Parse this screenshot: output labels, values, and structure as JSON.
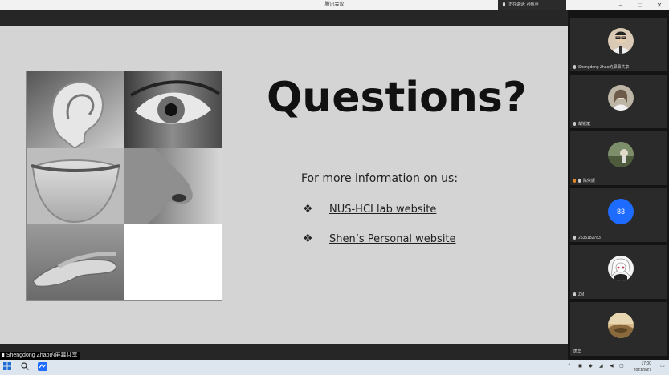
{
  "window": {
    "title": "腾讯会议",
    "controls": [
      "–",
      "□",
      "✕"
    ]
  },
  "speaking": {
    "label": "正在讲话: 孙帆丝"
  },
  "slide": {
    "headline": "Questions?",
    "info": "For more information on us:",
    "bullet": "❖",
    "links": [
      "NUS-HCI lab website",
      "Shen’s Personal website"
    ]
  },
  "share": {
    "label": "Shengdong Zhao的屏幕共享"
  },
  "participants": [
    {
      "name": "Shengdong Zhao的屏幕共享",
      "avatar": "man-glasses"
    },
    {
      "name": "胡锐斌",
      "avatar": "woman-portrait"
    },
    {
      "name": "陈依妮",
      "avatar": "outdoor-photo"
    },
    {
      "name": "2535182783",
      "avatar": "83",
      "color": "#1e6bff"
    },
    {
      "name": "ZM",
      "avatar": "anime-character"
    },
    {
      "name": "唐华",
      "avatar": "landscape-photo"
    }
  ],
  "taskbar": {
    "clock_time": "17:00",
    "clock_date": "2021/9/27"
  }
}
